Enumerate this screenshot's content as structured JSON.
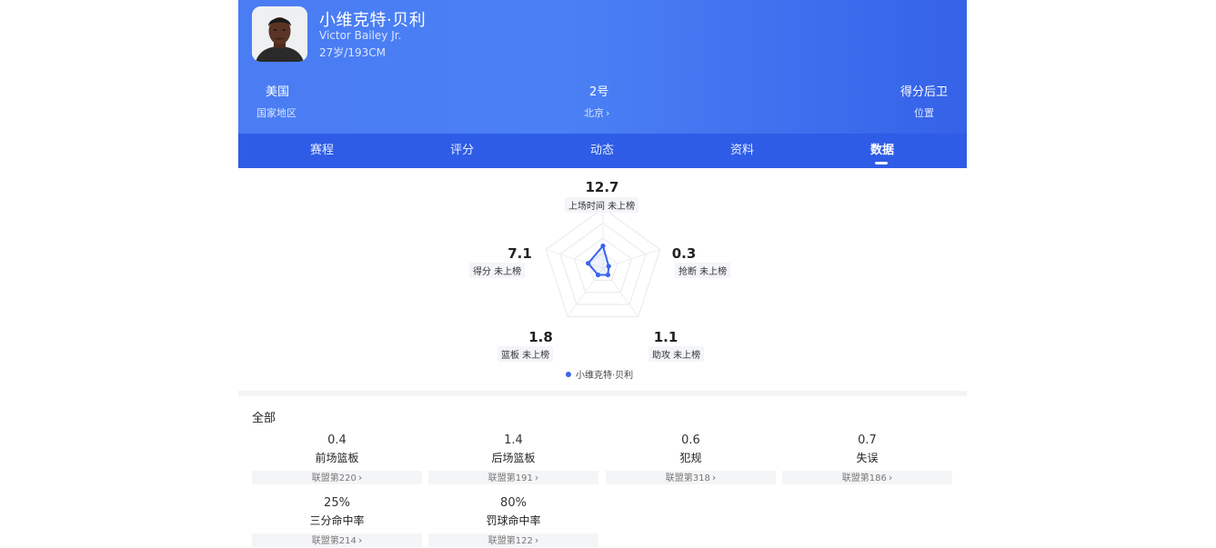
{
  "player": {
    "name_cn": "小维克特·贝利",
    "name_en": "Victor Bailey Jr.",
    "meta": "27岁/193CM"
  },
  "info": [
    {
      "value": "美国",
      "label": "国家地区"
    },
    {
      "value": "2号",
      "label": "北京"
    },
    {
      "value": "得分后卫",
      "label": "位置"
    }
  ],
  "tabs": [
    "赛程",
    "评分",
    "动态",
    "资料",
    "数据"
  ],
  "active_tab": "数据",
  "radar": {
    "axes": [
      {
        "value": "12.7",
        "label": "上场时间 未上榜"
      },
      {
        "value": "0.3",
        "label": "抢断 未上榜"
      },
      {
        "value": "1.1",
        "label": "助攻 未上榜"
      },
      {
        "value": "1.8",
        "label": "篮板 未上榜"
      },
      {
        "value": "7.1",
        "label": "得分 未上榜"
      }
    ],
    "levels": [
      0.37,
      0.1,
      0.14,
      0.14,
      0.26
    ],
    "legend": "小维克特·贝利",
    "series_color": "#3a63ee"
  },
  "section_title": "全部",
  "stats": [
    {
      "value": "0.4",
      "name": "前场篮板",
      "rank": "联盟第220"
    },
    {
      "value": "1.4",
      "name": "后场篮板",
      "rank": "联盟第191"
    },
    {
      "value": "0.6",
      "name": "犯规",
      "rank": "联盟第318"
    },
    {
      "value": "0.7",
      "name": "失误",
      "rank": "联盟第186"
    },
    {
      "value": "25%",
      "name": "三分命中率",
      "rank": "联盟第214"
    },
    {
      "value": "80%",
      "name": "罚球命中率",
      "rank": "联盟第122"
    }
  ]
}
